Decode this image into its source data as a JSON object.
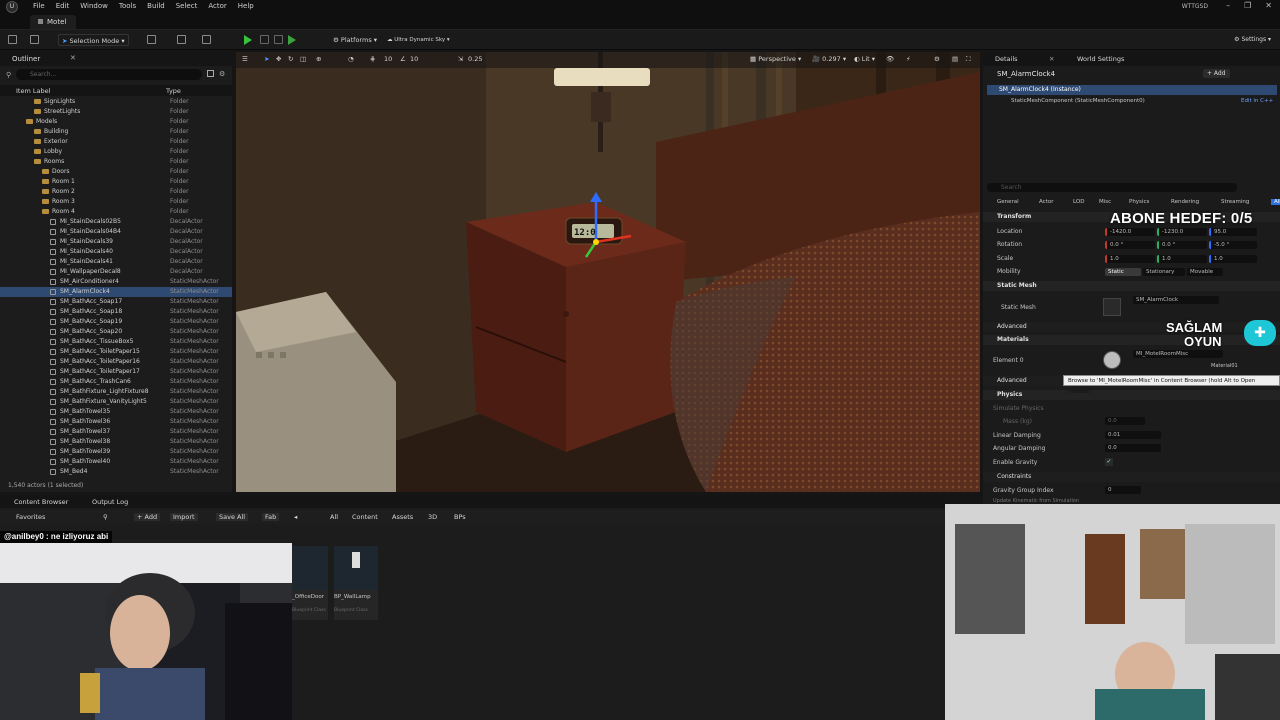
{
  "menubar": {
    "items": [
      "File",
      "Edit",
      "Window",
      "Tools",
      "Build",
      "Select",
      "Actor",
      "Help"
    ],
    "project": "WTTGSD"
  },
  "doc_tab": "Motel",
  "toolbar": {
    "mode": "Selection Mode",
    "platforms": "Platforms",
    "sky": "Ultra Dynamic Sky"
  },
  "outliner": {
    "title": "Outliner",
    "search_placeholder": "Search...",
    "col_label": "Item Label",
    "col_type": "Type",
    "rows": [
      {
        "name": "SignLights",
        "type": "Folder",
        "indent": 4,
        "kind": "folder"
      },
      {
        "name": "StreetLights",
        "type": "Folder",
        "indent": 4,
        "kind": "folder"
      },
      {
        "name": "Models",
        "type": "Folder",
        "indent": 3,
        "kind": "folder"
      },
      {
        "name": "Building",
        "type": "Folder",
        "indent": 4,
        "kind": "folder"
      },
      {
        "name": "Exterior",
        "type": "Folder",
        "indent": 4,
        "kind": "folder"
      },
      {
        "name": "Lobby",
        "type": "Folder",
        "indent": 4,
        "kind": "folder"
      },
      {
        "name": "Rooms",
        "type": "Folder",
        "indent": 4,
        "kind": "folder"
      },
      {
        "name": "Doors",
        "type": "Folder",
        "indent": 5,
        "kind": "folder"
      },
      {
        "name": "Room 1",
        "type": "Folder",
        "indent": 5,
        "kind": "folder"
      },
      {
        "name": "Room 2",
        "type": "Folder",
        "indent": 5,
        "kind": "folder"
      },
      {
        "name": "Room 3",
        "type": "Folder",
        "indent": 5,
        "kind": "folder"
      },
      {
        "name": "Room 4",
        "type": "Folder",
        "indent": 5,
        "kind": "folder"
      },
      {
        "name": "MI_StainDecals02B5",
        "type": "DecalActor",
        "indent": 6,
        "kind": "actor"
      },
      {
        "name": "MI_StainDecals04B4",
        "type": "DecalActor",
        "indent": 6,
        "kind": "actor"
      },
      {
        "name": "MI_StainDecals39",
        "type": "DecalActor",
        "indent": 6,
        "kind": "actor"
      },
      {
        "name": "MI_StainDecals40",
        "type": "DecalActor",
        "indent": 6,
        "kind": "actor"
      },
      {
        "name": "MI_StainDecals41",
        "type": "DecalActor",
        "indent": 6,
        "kind": "actor"
      },
      {
        "name": "MI_WallpaperDecal8",
        "type": "DecalActor",
        "indent": 6,
        "kind": "actor"
      },
      {
        "name": "SM_AirConditioner4",
        "type": "StaticMeshActor",
        "indent": 6,
        "kind": "actor"
      },
      {
        "name": "SM_AlarmClock4",
        "type": "StaticMeshActor",
        "indent": 6,
        "kind": "actor",
        "selected": true
      },
      {
        "name": "SM_BathAcc_Soap17",
        "type": "StaticMeshActor",
        "indent": 6,
        "kind": "actor"
      },
      {
        "name": "SM_BathAcc_Soap18",
        "type": "StaticMeshActor",
        "indent": 6,
        "kind": "actor"
      },
      {
        "name": "SM_BathAcc_Soap19",
        "type": "StaticMeshActor",
        "indent": 6,
        "kind": "actor"
      },
      {
        "name": "SM_BathAcc_Soap20",
        "type": "StaticMeshActor",
        "indent": 6,
        "kind": "actor"
      },
      {
        "name": "SM_BathAcc_TissueBox5",
        "type": "StaticMeshActor",
        "indent": 6,
        "kind": "actor"
      },
      {
        "name": "SM_BathAcc_ToiletPaper15",
        "type": "StaticMeshActor",
        "indent": 6,
        "kind": "actor"
      },
      {
        "name": "SM_BathAcc_ToiletPaper16",
        "type": "StaticMeshActor",
        "indent": 6,
        "kind": "actor"
      },
      {
        "name": "SM_BathAcc_ToiletPaper17",
        "type": "StaticMeshActor",
        "indent": 6,
        "kind": "actor"
      },
      {
        "name": "SM_BathAcc_TrashCan6",
        "type": "StaticMeshActor",
        "indent": 6,
        "kind": "actor"
      },
      {
        "name": "SM_BathFixture_LightFixture8",
        "type": "StaticMeshActor",
        "indent": 6,
        "kind": "actor"
      },
      {
        "name": "SM_BathFixture_VanityLight5",
        "type": "StaticMeshActor",
        "indent": 6,
        "kind": "actor"
      },
      {
        "name": "SM_BathTowel35",
        "type": "StaticMeshActor",
        "indent": 6,
        "kind": "actor"
      },
      {
        "name": "SM_BathTowel36",
        "type": "StaticMeshActor",
        "indent": 6,
        "kind": "actor"
      },
      {
        "name": "SM_BathTowel37",
        "type": "StaticMeshActor",
        "indent": 6,
        "kind": "actor"
      },
      {
        "name": "SM_BathTowel38",
        "type": "StaticMeshActor",
        "indent": 6,
        "kind": "actor"
      },
      {
        "name": "SM_BathTowel39",
        "type": "StaticMeshActor",
        "indent": 6,
        "kind": "actor"
      },
      {
        "name": "SM_BathTowel40",
        "type": "StaticMeshActor",
        "indent": 6,
        "kind": "actor"
      },
      {
        "name": "SM_Bed4",
        "type": "StaticMeshActor",
        "indent": 6,
        "kind": "actor"
      }
    ],
    "footer": "1,540 actors (1 selected)"
  },
  "viewport": {
    "perspective": "Perspective",
    "lit": "Lit",
    "grid_snap": "10",
    "rot_snap": "10",
    "scale_snap": "0.25",
    "cam_speed": "0.297",
    "clock_text": "12:0"
  },
  "details": {
    "tab_details": "Details",
    "tab_world": "World Settings",
    "actor_name": "SM_AlarmClock4",
    "add_label": "+ Add",
    "instance": "SM_AlarmClock4 (Instance)",
    "component": "StaticMeshComponent (StaticMeshComponent0)",
    "edit_cpp": "Edit in C++",
    "search_placeholder": "Search",
    "filters": [
      "General",
      "Actor",
      "LOD",
      "Misc",
      "Physics",
      "Rendering",
      "Streaming",
      "All"
    ],
    "transform": "Transform",
    "location_label": "Location",
    "rotation_label": "Rotation",
    "scale_label": "Scale",
    "mobility_label": "Mobility",
    "location": [
      "-1420.0",
      "-1230.0",
      "95.0"
    ],
    "rotation": [
      "0.0 °",
      "0.0 °",
      "-5.0 °"
    ],
    "scale": [
      "1.0",
      "1.0",
      "1.0"
    ],
    "mobility": [
      "Static",
      "Stationary",
      "Movable"
    ],
    "static_mesh_section": "Static Mesh",
    "static_mesh_label": "Static Mesh",
    "static_mesh_value": "SM_AlarmClock",
    "advanced": "Advanced",
    "materials_section": "Materials",
    "element0": "Element 0",
    "material_value": "MI_MotelRoomMisc",
    "material_sub": "Material01",
    "physics_section": "Physics",
    "simulate_physics": "Simulate Physics",
    "mass": "Mass (kg)",
    "mass_value": "0.0",
    "linear_damping": "Linear Damping",
    "linear_damping_value": "0.01",
    "angular_damping": "Angular Damping",
    "angular_damping_value": "0.0",
    "enable_gravity": "Enable Gravity",
    "constraints": "Constraints",
    "gravity_group": "Gravity Group Index",
    "gravity_group_value": "0",
    "update_kinematic": "Update Kinematic from Simulation",
    "tooltip": "Browse to 'MI_MotelRoomMisc' in Content Browser (hold Alt to Open instead)"
  },
  "content_browser": {
    "tab": "Content Browser",
    "tab_log": "Output Log",
    "favorites": "Favorites",
    "add": "+ Add",
    "import": "Import",
    "save_all": "Save All",
    "fab": "Fab",
    "path": [
      "All",
      "Content",
      "Assets",
      "3D",
      "BPs"
    ],
    "assets": [
      {
        "name": "_OfficeDoor",
        "sub": "Blueprint Class"
      },
      {
        "name": "BP_WallLamp",
        "sub": "Blueprint Class"
      }
    ]
  },
  "overlay": {
    "goal": "ABONE HEDEF: 0/5",
    "brand_line1": "SAĞLAM",
    "brand_line2": "OYUN",
    "chat": "@anilbey0 : ne izliyoruz abi"
  }
}
